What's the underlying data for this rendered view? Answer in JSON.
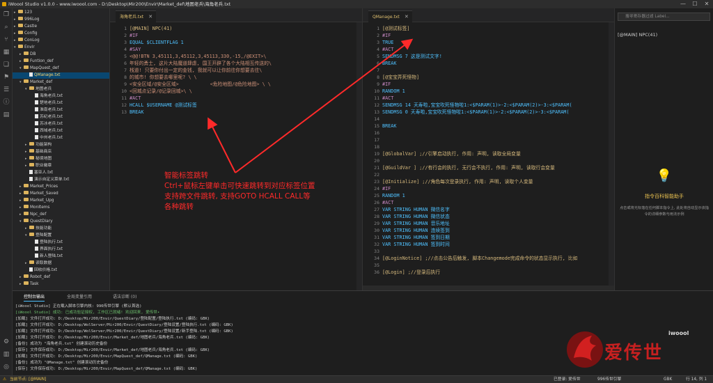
{
  "titlebar": {
    "title": "iWoool Studio v1.0.0 - www.iwoool.com - D:\\Desktop\\Mir200\\Envir\\Market_def\\地图老兵\\海角老兵.txt",
    "min": "—",
    "max": "☐",
    "close": "✕"
  },
  "activity_icons": [
    "files-icon",
    "search-icon",
    "git-icon",
    "extensions-icon",
    "copy-icon",
    "bookmark-icon",
    "list-icon",
    "info-icon",
    "chart-icon",
    "settings-icon",
    "book-icon",
    "target-icon"
  ],
  "tree": [
    {
      "l": "123",
      "d": 1,
      "t": "f",
      "o": 0
    },
    {
      "l": "996Log",
      "d": 1,
      "t": "f",
      "o": 0
    },
    {
      "l": "Castle",
      "d": 1,
      "t": "f",
      "o": 0
    },
    {
      "l": "Config",
      "d": 1,
      "t": "f",
      "o": 0
    },
    {
      "l": "ConLog",
      "d": 1,
      "t": "f",
      "o": 0
    },
    {
      "l": "Envir",
      "d": 1,
      "t": "f",
      "o": 1
    },
    {
      "l": "DB",
      "d": 2,
      "t": "f",
      "o": 0
    },
    {
      "l": "Funtion_def",
      "d": 2,
      "t": "f",
      "o": 0
    },
    {
      "l": "MapQuest_def",
      "d": 2,
      "t": "f",
      "o": 1
    },
    {
      "l": "QManage.txt",
      "d": 3,
      "t": "x",
      "sel": 1
    },
    {
      "l": "Market_def",
      "d": 2,
      "t": "f",
      "o": 1
    },
    {
      "l": "地图老兵",
      "d": 3,
      "t": "f",
      "o": 1
    },
    {
      "l": "海角老兵.txt",
      "d": 4,
      "t": "x"
    },
    {
      "l": "楚地老兵.txt",
      "d": 4,
      "t": "x"
    },
    {
      "l": "淮南老兵.txt",
      "d": 4,
      "t": "x"
    },
    {
      "l": "苏纪老兵.txt",
      "d": 4,
      "t": "x"
    },
    {
      "l": "苏冰老兵.txt",
      "d": 4,
      "t": "x"
    },
    {
      "l": "西域老兵.txt",
      "d": 4,
      "t": "x"
    },
    {
      "l": "中州老兵.txt",
      "d": 4,
      "t": "x"
    },
    {
      "l": "功能架构",
      "d": 3,
      "t": "f",
      "o": 0
    },
    {
      "l": "基础商店",
      "d": 3,
      "t": "f",
      "o": 0
    },
    {
      "l": "秘境地图",
      "d": 3,
      "t": "f",
      "o": 0
    },
    {
      "l": "职业徽章",
      "d": 3,
      "t": "f",
      "o": 0
    },
    {
      "l": "塞亚人.txt",
      "d": 3,
      "t": "x"
    },
    {
      "l": "演示自定义菜单.txt",
      "d": 3,
      "t": "x"
    },
    {
      "l": "Market_Prices",
      "d": 2,
      "t": "f",
      "o": 0
    },
    {
      "l": "Market_Saved",
      "d": 2,
      "t": "f",
      "o": 0
    },
    {
      "l": "Market_Upg",
      "d": 2,
      "t": "f",
      "o": 0
    },
    {
      "l": "MonItems",
      "d": 2,
      "t": "f",
      "o": 0
    },
    {
      "l": "Npc_def",
      "d": 2,
      "t": "f",
      "o": 0
    },
    {
      "l": "QuestDiary",
      "d": 2,
      "t": "f",
      "o": 1
    },
    {
      "l": "技能功能",
      "d": 3,
      "t": "f",
      "o": 0
    },
    {
      "l": "登陆配置",
      "d": 3,
      "t": "f",
      "o": 1
    },
    {
      "l": "登陆执行.txt",
      "d": 4,
      "t": "x"
    },
    {
      "l": "界面执行.txt",
      "d": 4,
      "t": "x"
    },
    {
      "l": "新人登陆.txt",
      "d": 4,
      "t": "x"
    },
    {
      "l": "读取数据",
      "d": 3,
      "t": "f",
      "o": 0
    },
    {
      "l": "回收价格.txt",
      "d": 3,
      "t": "x"
    },
    {
      "l": "Robot_def",
      "d": 2,
      "t": "f",
      "o": 0
    },
    {
      "l": "Task",
      "d": 2,
      "t": "f",
      "o": 0
    }
  ],
  "editor1": {
    "tab": "海角老兵.txt",
    "close": "✕",
    "lines": [
      {
        "n": "1",
        "c": "[@MAIN] NPC(41)",
        "k": "head"
      },
      {
        "n": "2",
        "c": "#IF",
        "k": "kw"
      },
      {
        "n": "3",
        "c": "EQUAL $CLIENTFLAG 1",
        "k": "cmd"
      },
      {
        "n": "4",
        "c": "#SAY",
        "k": "kw"
      },
      {
        "n": "5",
        "c": "<@@!BTN 3,45111,3,45112,3,45113,330,-15,/@EXIT>\\",
        "k": "str"
      },
      {
        "n": "6",
        "c": "年轻的勇士, 这片大陆魔道肆虐, 国王开辟了各个大陆相互传送的\\",
        "k": "str"
      },
      {
        "n": "7",
        "c": "栈道! 只要你付出一定的金钱, 我就可以让你前往你想要去往\\",
        "k": "str"
      },
      {
        "n": "8",
        "c": "的城市! 你想要去哪里呢? \\ \\",
        "k": "str"
      },
      {
        "n": "9",
        "c": "<安全区域/@安全区域>           <危险地图/@危险地图> \\ \\",
        "k": "str"
      },
      {
        "n": "10",
        "c": "<回城点记录/@记录回城>\\ \\",
        "k": "str"
      },
      {
        "n": "11",
        "c": "#ACT",
        "k": "kw"
      },
      {
        "n": "12",
        "c": "HCALL $USERNAME @测试标签",
        "k": "cmd"
      },
      {
        "n": "13",
        "c": "BREAK",
        "k": "cmd"
      }
    ]
  },
  "editor2": {
    "tab": "QManage.txt",
    "close": "✕",
    "lines": [
      {
        "n": "1",
        "c": "[@测试标签]",
        "k": "head"
      },
      {
        "n": "2",
        "c": "#IF",
        "k": "kw"
      },
      {
        "n": "3",
        "c": "TRUE",
        "k": "cmd"
      },
      {
        "n": "4",
        "c": "#ACT",
        "k": "kw"
      },
      {
        "n": "5",
        "c": "SENDMSG 7 这是测试文字!",
        "k": "cmd"
      },
      {
        "n": "6",
        "c": "BREAK",
        "k": "cmd"
      },
      {
        "n": "7",
        "c": "",
        "k": "plain"
      },
      {
        "n": "8",
        "c": "[@宝宝弄死怪物]",
        "k": "head"
      },
      {
        "n": "9",
        "c": "#IF",
        "k": "kw"
      },
      {
        "n": "10",
        "c": "RANDOM 1",
        "k": "cmd"
      },
      {
        "n": "11",
        "c": "#ACT",
        "k": "kw"
      },
      {
        "n": "12",
        "c": "SENDMSG 14 天寿啦,宝宝吹死怪物啦1:<$PARAM(1)>-2:<$PARAM(2)>-3:<$PARAM(",
        "k": "cmd"
      },
      {
        "n": "13",
        "c": "SENDMSG 0 天寿啦,宝宝吹死怪物啦1:<$PARAM(1)>-2:<$PARAM(2)>-3:<$PARAM(",
        "k": "cmd"
      },
      {
        "n": "14",
        "c": "",
        "k": "plain"
      },
      {
        "n": "15",
        "c": "BREAK",
        "k": "cmd"
      },
      {
        "n": "16",
        "c": "",
        "k": "plain"
      },
      {
        "n": "17",
        "c": "",
        "k": "plain"
      },
      {
        "n": "18",
        "c": "",
        "k": "plain"
      },
      {
        "n": "19",
        "c": "[@GlobalVar] ;//引擎启动执行, 作用: 声明, 读取全局变量",
        "k": "head"
      },
      {
        "n": "20",
        "c": "",
        "k": "plain"
      },
      {
        "n": "21",
        "c": "[@GuildVar ] ;//有行会的执行, 无行会不执行, 作用: 声明, 读取行会变量",
        "k": "head"
      },
      {
        "n": "22",
        "c": "",
        "k": "plain"
      },
      {
        "n": "23",
        "c": "[@Initialize] ;//角色每次登录执行, 作用: 声明, 读取个人变量",
        "k": "head"
      },
      {
        "n": "24",
        "c": "#IF",
        "k": "kw"
      },
      {
        "n": "25",
        "c": "RANDOM 1",
        "k": "cmd"
      },
      {
        "n": "26",
        "c": "#ACT",
        "k": "kw"
      },
      {
        "n": "27",
        "c": "VAR STRING HUMAN 微信名字",
        "k": "cmd"
      },
      {
        "n": "28",
        "c": "VAR STRING HUMAN 微信状态",
        "k": "cmd"
      },
      {
        "n": "29",
        "c": "VAR STRING HUMAN 音乐地址",
        "k": "cmd"
      },
      {
        "n": "30",
        "c": "VAR STRING HUMAN 连续签到",
        "k": "cmd"
      },
      {
        "n": "31",
        "c": "VAR STRING HUMAN 签到日期",
        "k": "cmd"
      },
      {
        "n": "32",
        "c": "VAR STRING HUMAN 签到时间",
        "k": "cmd"
      },
      {
        "n": "33",
        "c": "",
        "k": "plain"
      },
      {
        "n": "34",
        "c": "[@LoginNotice] ;//点击公告后触发, 脚本Changemode完成命令的状态显示执行, 比如",
        "k": "head"
      },
      {
        "n": "35",
        "c": "",
        "k": "plain"
      },
      {
        "n": "36",
        "c": "[@Login] ;//登录后执行",
        "k": "head"
      }
    ]
  },
  "right_panel": {
    "search_placeholder": "搜寻寄存器过滤 Label...",
    "outline_item": "[@MAIN] NPC(41)",
    "helper_title": "指令百科智能助手",
    "helper_desc": "点击或将光标落在任何脚本指令上, 此处将自动显示该指令的详细参数与用法示例"
  },
  "annotation": [
    "智能标签跳转",
    "Ctrl+鼠标左键单击可快速跳转到对应标签位置",
    "支持跨文件跳转, 支持GOTO HCALL CALL等",
    "各种跳转"
  ],
  "bottom": {
    "tabs": [
      "控制台输出",
      "全局变量引用",
      "语法诊断 (0)"
    ],
    "logs": [
      "[iWoool Studio] 正在载入脚本引擎内核: 996传世引擎 (默认首选)",
      "[iWoool Studio] 成功: 已成功验证授权, 工作区已就绪! 欢迎回来, 爱传世•",
      "[加载] 文件打开成功: D:/Desktop/Mir200/Envir/QuestDiary/登陆配置/登陆执行.txt (编码: GBK)",
      "[加载] 文件打开成功: D:/Desktop/WolServer/Mir200/Envir/QuestDiary/登陆设置/登陆执行.txt (编码: GBK)",
      "[加载] 文件打开成功: D:/Desktop/WolServer/Mir200/Envir/QuestDiary/登陆设置/新手登陆.txt (编码: GBK)",
      "[加载] 文件打开成功: D:/Desktop/Mir200/Envir/Market_def/地图老兵/海角老兵.txt (编码: GBK)",
      "[备份] 成功为 \"海角老兵.txt\" 创建滚动历史备份",
      "[保存] 文件保存成功: D:/Desktop/Mir200/Envir/Market_def/地图老兵/海角老兵.txt (编码: GBK)",
      "[加载] 文件打开成功: D:/Desktop/Mir200/Envir/MapQuest_def/QManage.txt (编码: GBK)",
      "[备份] 成功为 \"QManage.txt\" 创建滚动历史备份",
      "[保存] 文件保存成功: D:/Desktop/Mir200/Envir/MapQuest_def/QManage.txt (编码: GBK)"
    ]
  },
  "status": {
    "left": "当前节点: [@MAIN]",
    "auth": "已登录: 爱传世",
    "engine": "996传世引擎",
    "encoding": "GBK",
    "pos": "行 14, 列 1"
  },
  "watermark": {
    "text": "爱传世",
    "sub": "iwoool"
  },
  "colors": {
    "annotation": "#ff2a2a",
    "accent": "#e0a000"
  }
}
